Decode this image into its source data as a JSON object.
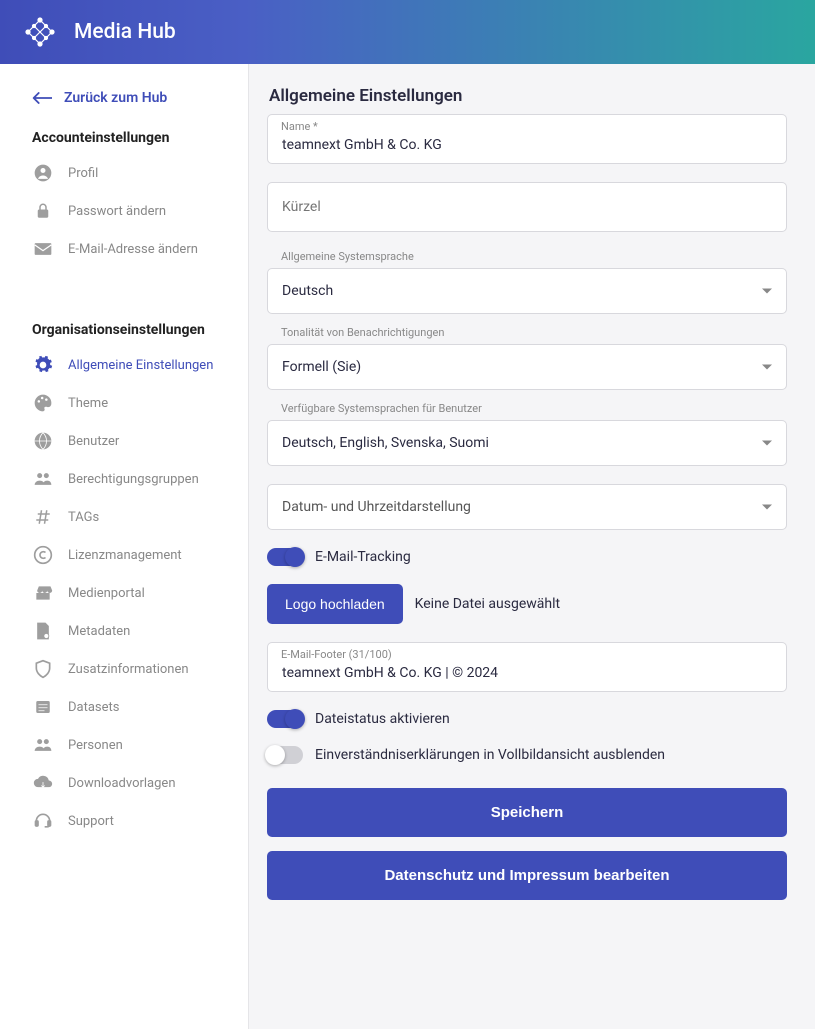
{
  "appTitle": "Media Hub",
  "backLink": "Zurück zum Hub",
  "sections": {
    "account": {
      "title": "Accounteinstellungen",
      "items": [
        "Profil",
        "Passwort ändern",
        "E-Mail-Adresse ändern"
      ]
    },
    "org": {
      "title": "Organisationseinstellungen",
      "items": [
        "Allgemeine Einstellungen",
        "Theme",
        "Benutzer",
        "Berechtigungsgruppen",
        "TAGs",
        "Lizenzmanagement",
        "Medienportal",
        "Metadaten",
        "Zusatzinformationen",
        "Datasets",
        "Personen",
        "Downloadvorlagen",
        "Support"
      ]
    }
  },
  "pageTitle": "Allgemeine Einstellungen",
  "fields": {
    "nameLabel": "Name *",
    "nameValue": "teamnext GmbH & Co. KG",
    "abbrevPlaceholder": "Kürzel",
    "syslangLabel": "Allgemeine Systemsprache",
    "syslangValue": "Deutsch",
    "tonalityLabel": "Tonalität von Benachrichtigungen",
    "tonalityValue": "Formell (Sie)",
    "availLangsLabel": "Verfügbare Systemsprachen für Benutzer",
    "availLangsValue": "Deutsch, English, Svenska, Suomi",
    "datetimeLabel": "Datum- und Uhrzeitdarstellung",
    "emailTrackingLabel": "E-Mail-Tracking",
    "uploadBtn": "Logo hochladen",
    "uploadStatus": "Keine Datei ausgewählt",
    "emailFooterLabel": "E-Mail-Footer (31/100)",
    "emailFooterValue": "teamnext GmbH & Co. KG | © 2024",
    "fileStatusLabel": "Dateistatus aktivieren",
    "consentHideLabel": "Einverständniserklärungen in Vollbildansicht ausblenden",
    "saveBtn": "Speichern",
    "privacyBtn": "Datenschutz und Impressum bearbeiten"
  },
  "colors": {
    "primary": "#3f4db8"
  }
}
